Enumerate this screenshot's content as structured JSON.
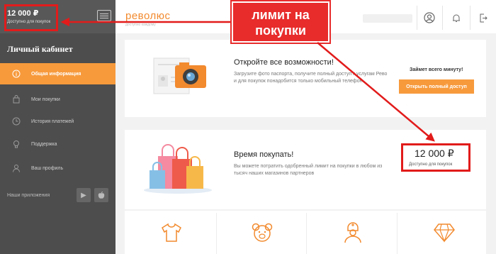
{
  "sidebar": {
    "amount": "12 000 ₽",
    "available": "Доступно для покупок",
    "title": "Личный кабинет",
    "items": [
      {
        "label": "Общая информация",
        "icon": "info-icon",
        "active": true
      },
      {
        "label": "Мои покупки",
        "icon": "shopping-bag-icon",
        "active": false
      },
      {
        "label": "История платежей",
        "icon": "history-icon",
        "active": false
      },
      {
        "label": "Поддержка",
        "icon": "lightbulb-icon",
        "active": false
      },
      {
        "label": "Ваш профиль",
        "icon": "user-icon",
        "active": false
      }
    ],
    "apps_label": "Наши приложения"
  },
  "header": {
    "logo": "революс",
    "logo_sub": "доступно каждому"
  },
  "card1": {
    "title": "Откройте все возможности!",
    "text": "Загрузите фото паспорта, получите полный доступ к услугам Рево и для покупок понадобится только мобильный телефон",
    "hint": "Займет всего минуту!",
    "button": "Открыть полный доступ"
  },
  "card2": {
    "title": "Время покупать!",
    "text": "Вы можете потратить одобренный лимит на покупки в любом из тысяч наших магазинов партнеров",
    "amount": "12 000 ₽",
    "amount_label": "Доступно для покупок"
  },
  "annotation": {
    "line1": "лимит на",
    "line2": "покупки",
    "color": "#e82c2c"
  },
  "colors": {
    "accent": "#f79a3c",
    "sidebar": "#4d4d4d"
  }
}
